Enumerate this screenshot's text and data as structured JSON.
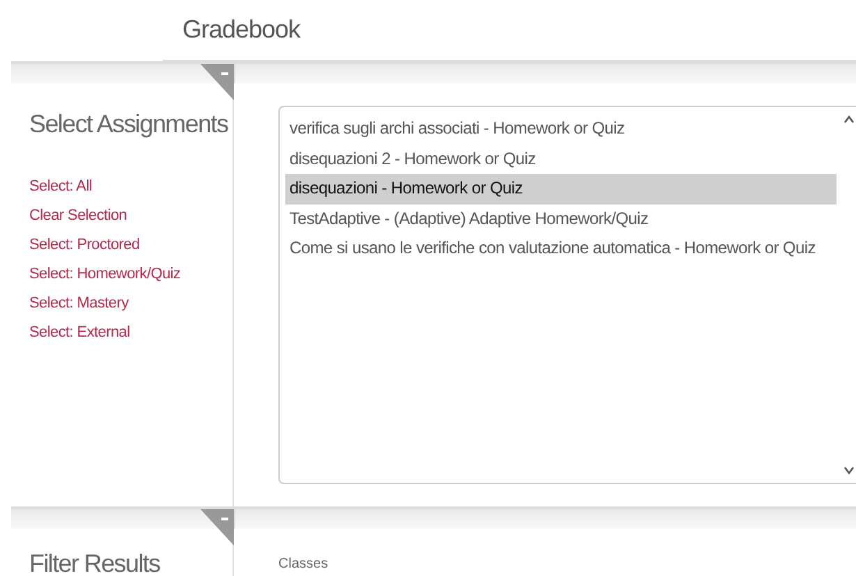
{
  "header": {
    "title": "Gradebook"
  },
  "select_section": {
    "title": "Select Assignments",
    "links": [
      "Select: All",
      "Clear Selection",
      "Select: Proctored",
      "Select: Homework/Quiz",
      "Select: Mastery",
      "Select: External"
    ],
    "assignments": [
      {
        "label": "verifica sugli archi associati - Homework or Quiz",
        "selected": false
      },
      {
        "label": "disequazioni 2 - Homework or Quiz",
        "selected": false
      },
      {
        "label": "disequazioni - Homework or Quiz",
        "selected": true
      },
      {
        "label": "TestAdaptive - (Adaptive) Adaptive Homework/Quiz",
        "selected": false
      },
      {
        "label": "Come si usano le verifiche con valutazione automatica - Homework or Quiz",
        "selected": false
      }
    ]
  },
  "filter_section": {
    "title": "Filter Results",
    "classes_label": "Classes"
  }
}
